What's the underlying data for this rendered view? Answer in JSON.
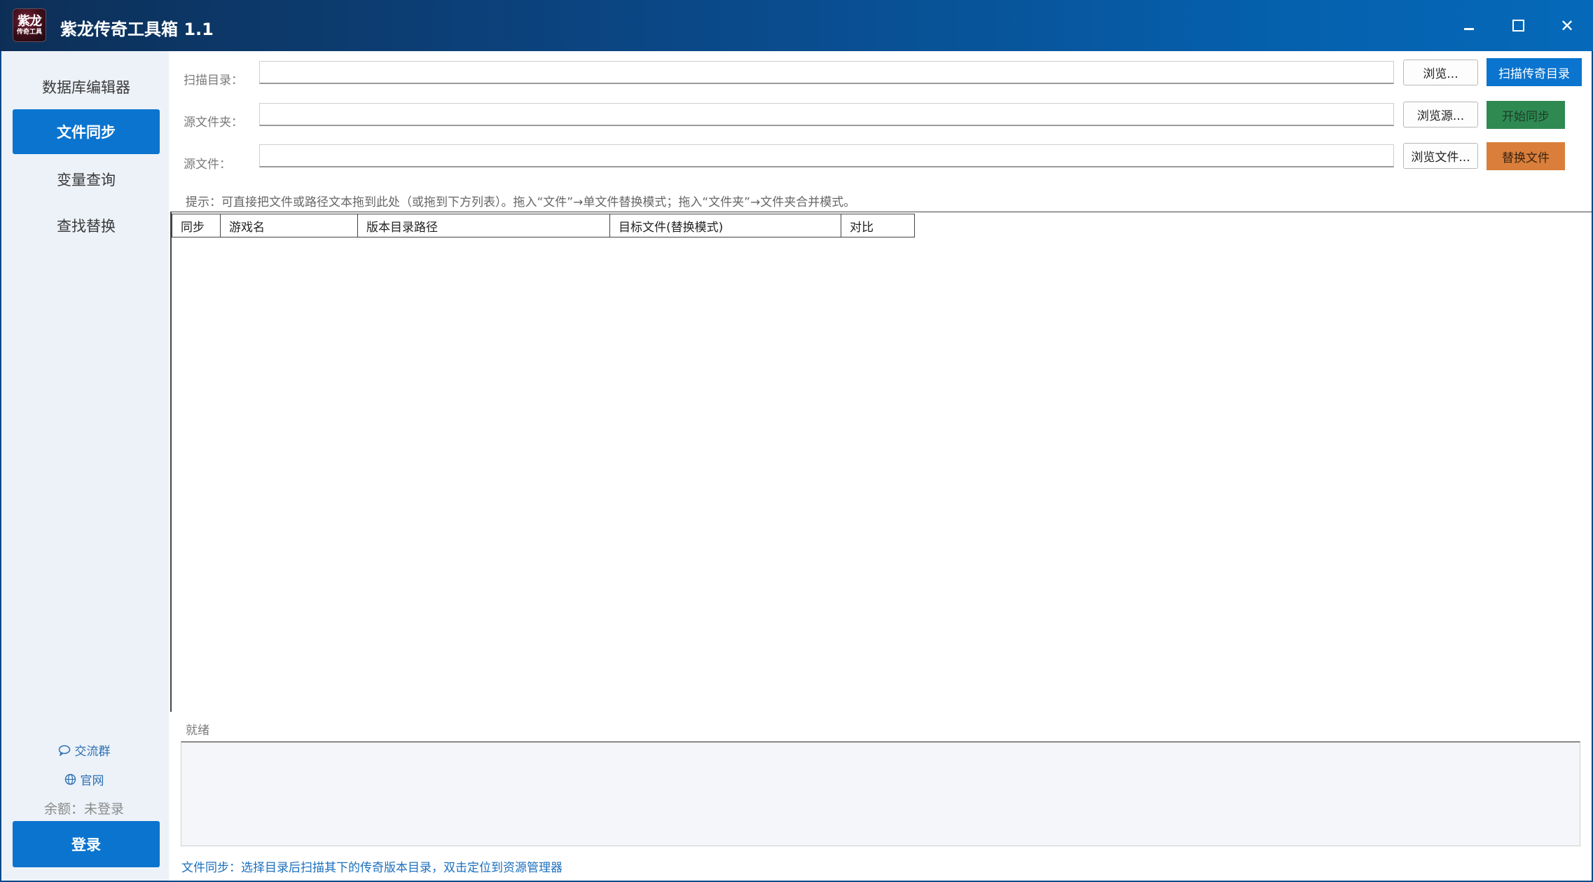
{
  "window": {
    "title": "紫龙传奇工具箱 1.1",
    "logo_line1": "紫龙",
    "logo_line2": "传奇工具",
    "close_glyph": "✕"
  },
  "sidebar": {
    "items": [
      {
        "label": "数据库编辑器",
        "active": false
      },
      {
        "label": "文件同步",
        "active": true
      },
      {
        "label": "变量查询",
        "active": false
      },
      {
        "label": "查找替换",
        "active": false
      }
    ],
    "community_link": "交流群",
    "website_link": "官网",
    "balance": "余额：未登录",
    "login_label": "登录"
  },
  "form": {
    "scan_dir": {
      "label": "扫描目录：",
      "value": "",
      "browse_label": "浏览...",
      "action_label": "扫描传奇目录"
    },
    "source_folder": {
      "label": "源文件夹：",
      "value": "",
      "browse_label": "浏览源...",
      "action_label": "开始同步"
    },
    "source_file": {
      "label": "源文件：",
      "value": "",
      "browse_label": "浏览文件...",
      "action_label": "替换文件"
    }
  },
  "hint": "提示：可直接把文件或路径文本拖到此处（或拖到下方列表）。拖入“文件”→单文件替换模式；拖入“文件夹”→文件夹合并模式。",
  "table": {
    "columns": [
      "同步",
      "游戏名",
      "版本目录路径",
      "目标文件(替换模式)",
      "对比"
    ],
    "rows": []
  },
  "status": "就绪",
  "log": "",
  "footer_tip": "文件同步：选择目录后扫描其下的传奇版本目录，双击定位到资源管理器",
  "colors": {
    "primary": "#0a74cf",
    "sync_button": "#2f8a52",
    "replace_button": "#d97f3b",
    "titlebar_start": "#0d2f57",
    "titlebar_end": "#0569b9"
  }
}
